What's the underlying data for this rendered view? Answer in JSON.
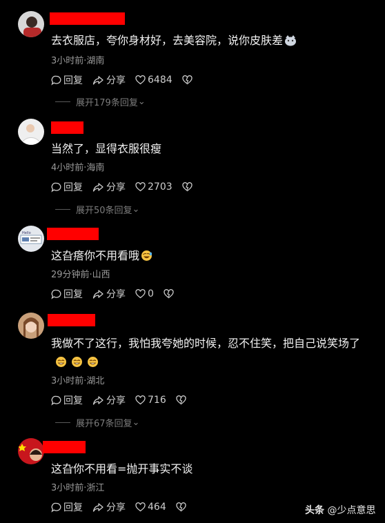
{
  "comments": [
    {
      "text": "去衣服店，夸你身材好，去美容院，说你皮肤差",
      "emoji": "cat-face-icon",
      "meta": "3小时前·湖南",
      "reply": "回复",
      "share": "分享",
      "likes": "6484",
      "expand": "展开179条回复"
    },
    {
      "text": "当然了，显得衣服很瘦",
      "meta": "4小时前·海南",
      "reply": "回复",
      "share": "分享",
      "likes": "2703",
      "expand": "展开50条回复"
    },
    {
      "text": "这旮瘩你不用看哦",
      "emoji": "rolling-laugh-icon",
      "meta": "29分钟前·山西",
      "reply": "回复",
      "share": "分享",
      "likes": "0"
    },
    {
      "text": "我做不了这行，我怕我夸她的时候，忍不住笑，把自己说笑场了",
      "emoji": "grin-icon",
      "meta": "3小时前·湖北",
      "reply": "回复",
      "share": "分享",
      "likes": "716",
      "expand": "展开67条回复"
    },
    {
      "text": "这旮你不用看=抛开事实不谈",
      "meta": "3小时前·浙江",
      "reply": "回复",
      "share": "分享",
      "likes": "464"
    }
  ],
  "watermark": {
    "brand": "头条",
    "account": "@少点意思"
  },
  "colors": {
    "background": "#000000",
    "redacted_name": "#ff0000",
    "meta_text": "#9a9a9a"
  }
}
